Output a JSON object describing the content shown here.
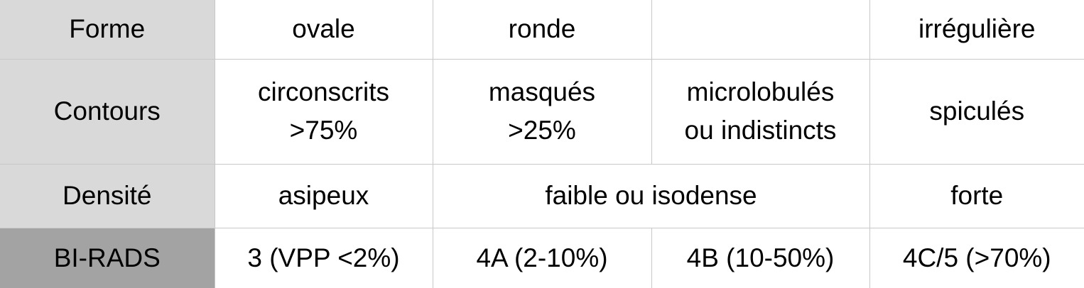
{
  "table": {
    "rows": {
      "forme": {
        "header": "Forme",
        "cells": [
          "ovale",
          "ronde",
          "",
          "irrégulière"
        ]
      },
      "contours": {
        "header": "Contours",
        "cells": [
          "circonscrits\n>75%",
          "masqués\n>25%",
          "microlobulés\nou indistincts",
          "spiculés"
        ]
      },
      "densite": {
        "header": "Densité",
        "cells": [
          "asipeux",
          "faible ou isodense",
          "forte"
        ]
      },
      "birads": {
        "header": "BI-RADS",
        "cells": [
          "3 (VPP <2%)",
          "4A (2-10%)",
          "4B (10-50%)",
          "4C/5 (>70%)"
        ]
      }
    },
    "colors": {
      "header_light": "#d9d9d9",
      "header_dark": "#a3a3a3",
      "grid": "#c8c8c8"
    }
  }
}
